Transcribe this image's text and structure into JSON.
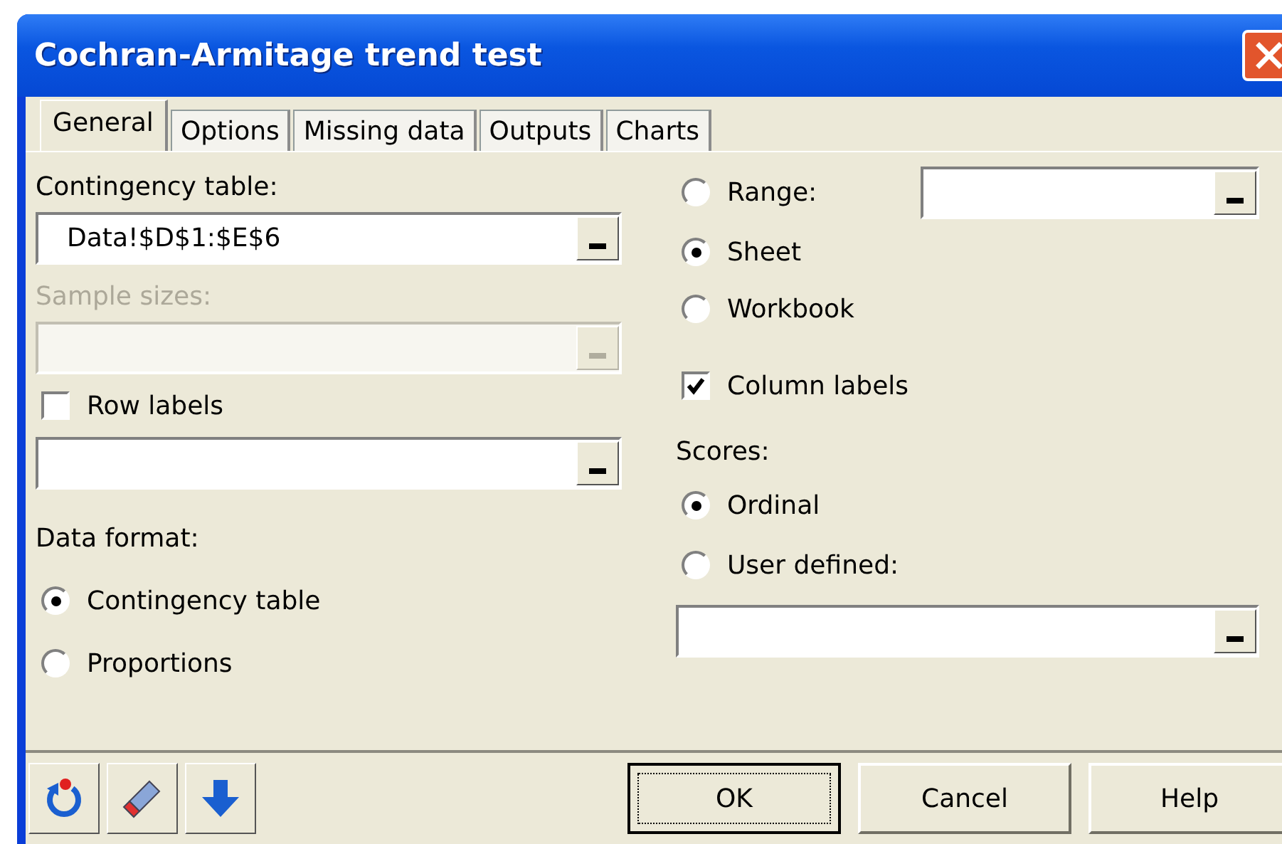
{
  "window": {
    "title": "Cochran-Armitage trend test"
  },
  "tabs": [
    {
      "label": "General",
      "selected": true
    },
    {
      "label": "Options",
      "selected": false
    },
    {
      "label": "Missing data",
      "selected": false
    },
    {
      "label": "Outputs",
      "selected": false
    },
    {
      "label": "Charts",
      "selected": false
    }
  ],
  "left": [
    {
      "kind": "label",
      "text": "Contingency table:",
      "disabled": false
    },
    {
      "kind": "field",
      "value": "Data!$D$1:$E$6",
      "disabled": false
    },
    {
      "kind": "label",
      "text": "Sample sizes:",
      "disabled": true
    },
    {
      "kind": "field",
      "disabled": true
    },
    {
      "kind": "checkbox",
      "text": "Row labels",
      "checked": false
    },
    {
      "kind": "field",
      "disabled": false
    },
    {
      "kind": "label",
      "text": "Data format:",
      "disabled": false
    },
    {
      "kind": "radio",
      "text": "Contingency table",
      "selected": true
    },
    {
      "kind": "radio",
      "text": "Proportions",
      "selected": false
    }
  ],
  "right": [
    {
      "kind": "radio",
      "text": "Range:",
      "selected": false,
      "field": true
    },
    {
      "kind": "radio",
      "text": "Sheet",
      "selected": true
    },
    {
      "kind": "radio",
      "text": "Workbook",
      "selected": false
    },
    {
      "kind": "checkbox",
      "text": "Column labels",
      "checked": true
    },
    {
      "kind": "label",
      "text": "Scores:",
      "disabled": false
    },
    {
      "kind": "radio",
      "text": "Ordinal",
      "selected": true
    },
    {
      "kind": "radio",
      "text": "User defined:",
      "selected": false
    },
    {
      "kind": "field",
      "disabled": false
    }
  ],
  "toolbar": [
    {
      "kind": "reset"
    },
    {
      "kind": "eraser"
    },
    {
      "kind": "down"
    }
  ],
  "buttons": [
    {
      "label": "OK",
      "default": true
    },
    {
      "label": "Cancel",
      "default": false
    },
    {
      "label": "Help",
      "default": false
    }
  ]
}
